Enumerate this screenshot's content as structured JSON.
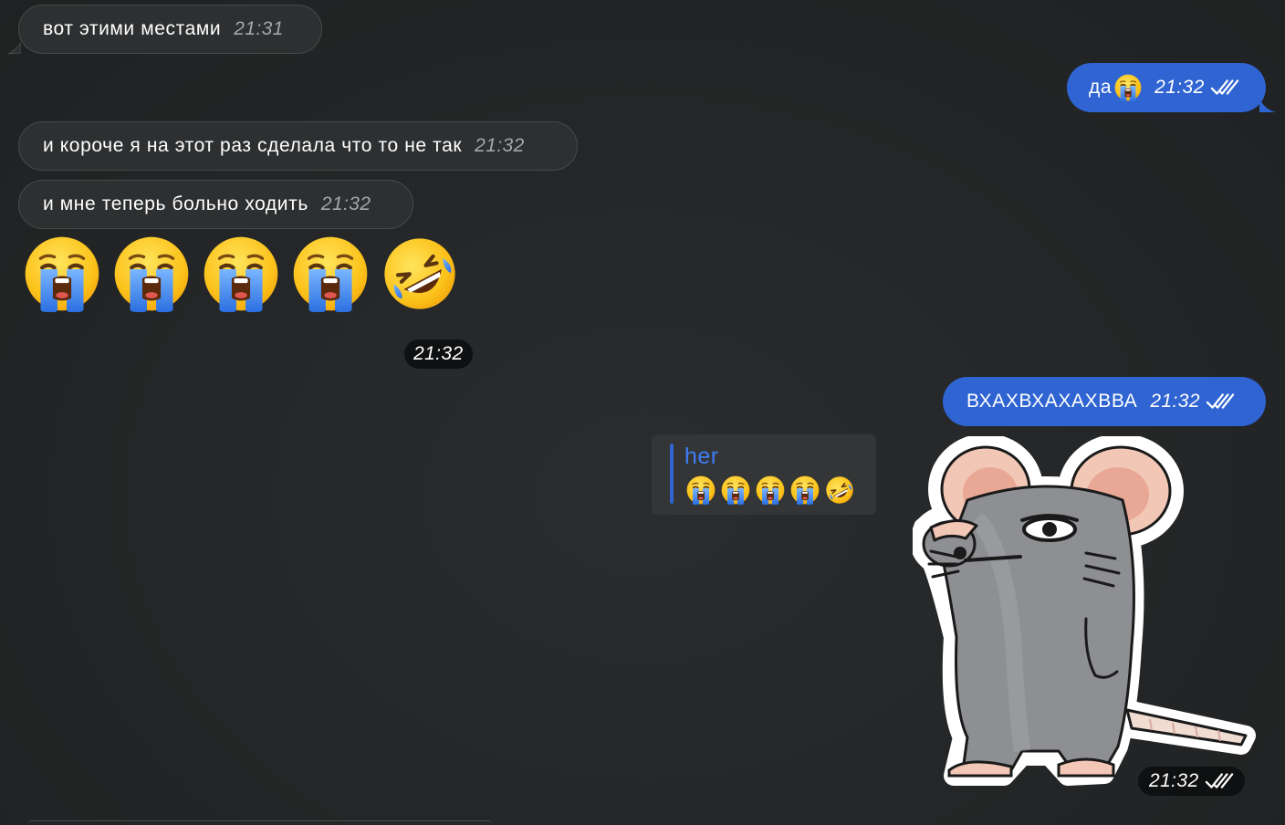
{
  "messages": [
    {
      "direction": "in",
      "text": "вот этими местами",
      "time": "21:31"
    },
    {
      "direction": "out",
      "text": "да",
      "emoji": "loudly-crying-face",
      "time": "21:32",
      "status": "read"
    },
    {
      "direction": "in",
      "text": "и короче я на этот раз сделала что то не так",
      "time": "21:32"
    },
    {
      "direction": "in",
      "text": "и мне теперь больно ходить",
      "time": "21:32"
    },
    {
      "direction": "in",
      "type": "big-emoji",
      "emojis": [
        "loudly-crying-face",
        "loudly-crying-face",
        "loudly-crying-face",
        "loudly-crying-face",
        "rolling-on-floor-laughing-face"
      ],
      "time": "21:32"
    },
    {
      "direction": "out",
      "text": "ВХАХВХАХАХВВА",
      "time": "21:32",
      "status": "read"
    },
    {
      "direction": "out",
      "type": "sticker",
      "sticker": "grey-mouse-sticker",
      "reply_to": {
        "name": "her",
        "emojis": [
          "loudly-crying-face",
          "loudly-crying-face",
          "loudly-crying-face",
          "loudly-crying-face",
          "rolling-on-floor-laughing-face"
        ]
      },
      "time": "21:32",
      "status": "read"
    }
  ],
  "colors": {
    "background": "#232526",
    "incoming_bubble": "#2d2f31",
    "outgoing_bubble": "#2f64d2",
    "reply_accent": "#3d7df5",
    "time_incoming": "#a4a7ab"
  }
}
